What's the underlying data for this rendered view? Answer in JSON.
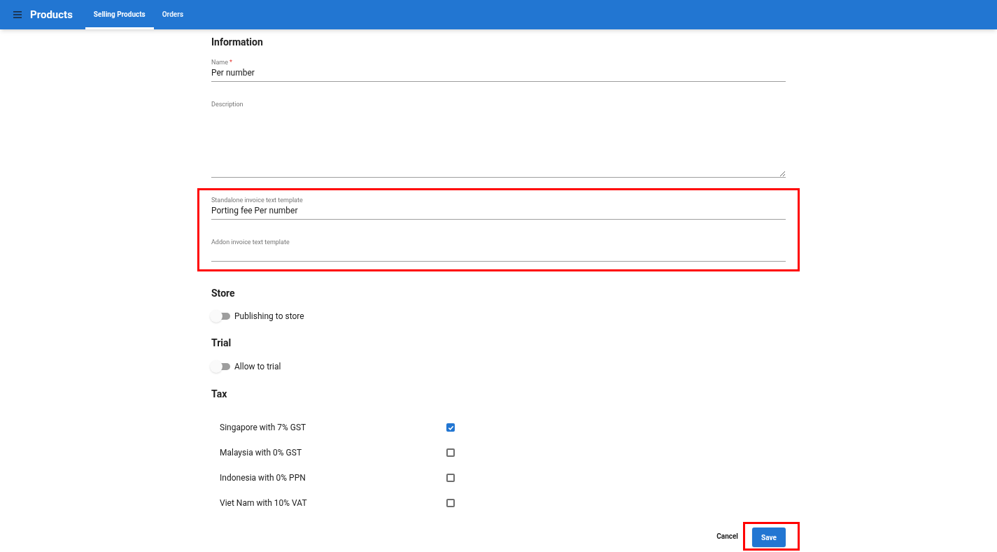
{
  "app_bar": {
    "title": "Products",
    "tabs": [
      {
        "label": "Selling Products",
        "selected": true
      },
      {
        "label": "Orders",
        "selected": false
      }
    ]
  },
  "information": {
    "heading": "Information",
    "name": {
      "label": "Name",
      "required_mark": "*",
      "value": "Per number"
    },
    "description": {
      "label": "Description"
    },
    "invoice_templates": {
      "highlighted": true,
      "fields": [
        {
          "label": "Standalone invoice text template",
          "value": "Porting fee Per number"
        },
        {
          "label": "Addon invoice text template"
        }
      ]
    }
  },
  "store": {
    "heading": "Store",
    "toggle": {
      "label": "Publishing to store",
      "on": false
    }
  },
  "trial": {
    "heading": "Trial",
    "toggle": {
      "label": "Allow to trial",
      "on": false
    }
  },
  "tax": {
    "heading": "Tax",
    "options": [
      {
        "label": "Singapore with 7% GST",
        "checked": true
      },
      {
        "label": "Malaysia with 0% GST",
        "checked": false
      },
      {
        "label": "Indonesia with 0% PPN",
        "checked": false
      },
      {
        "label": "Viet Nam with 10% VAT",
        "checked": false
      }
    ]
  },
  "actions": {
    "cancel": "Cancel",
    "save": {
      "label": "Save",
      "highlighted": true
    }
  }
}
